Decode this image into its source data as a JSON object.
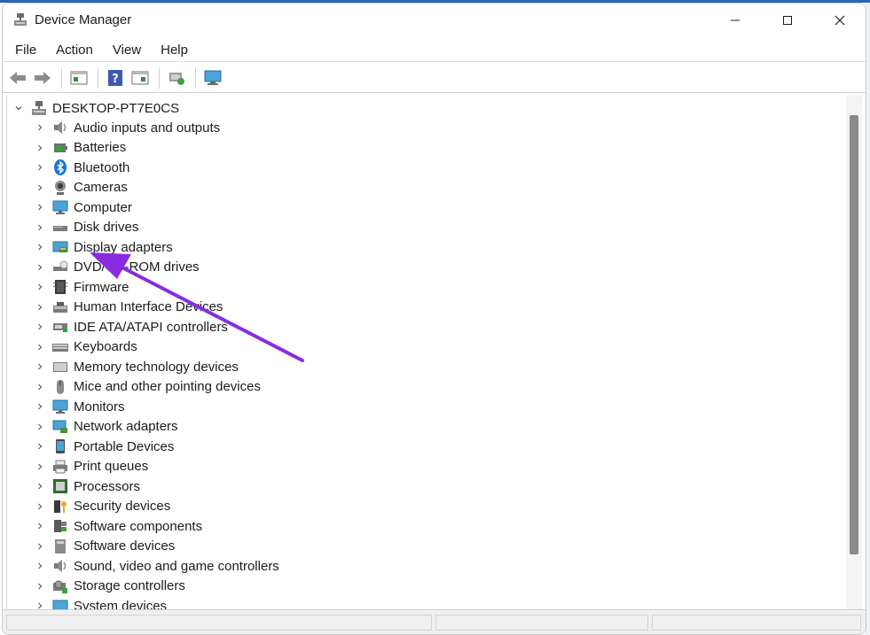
{
  "window": {
    "title": "Device Manager"
  },
  "menu": [
    "File",
    "Action",
    "View",
    "Help"
  ],
  "toolbar": {
    "buttons": [
      "back-arrow-icon",
      "forward-arrow-icon",
      "properties-icon",
      "help-icon",
      "view-icon",
      "update-driver-icon",
      "scan-hardware-icon"
    ]
  },
  "tree": {
    "root": "DESKTOP-PT7E0CS",
    "nodes": [
      {
        "label": "Audio inputs and outputs",
        "icon": "speaker-icon"
      },
      {
        "label": "Batteries",
        "icon": "battery-icon"
      },
      {
        "label": "Bluetooth",
        "icon": "bluetooth-icon"
      },
      {
        "label": "Cameras",
        "icon": "camera-icon"
      },
      {
        "label": "Computer",
        "icon": "monitor-icon"
      },
      {
        "label": "Disk drives",
        "icon": "disk-drive-icon"
      },
      {
        "label": "Display adapters",
        "icon": "display-adapter-icon"
      },
      {
        "label": "DVD/CD-ROM drives",
        "icon": "dvd-drive-icon"
      },
      {
        "label": "Firmware",
        "icon": "firmware-chip-icon"
      },
      {
        "label": "Human Interface Devices",
        "icon": "hid-icon"
      },
      {
        "label": "IDE ATA/ATAPI controllers",
        "icon": "ide-controller-icon"
      },
      {
        "label": "Keyboards",
        "icon": "keyboard-icon"
      },
      {
        "label": "Memory technology devices",
        "icon": "memory-icon"
      },
      {
        "label": "Mice and other pointing devices",
        "icon": "mouse-icon"
      },
      {
        "label": "Monitors",
        "icon": "monitor-icon"
      },
      {
        "label": "Network adapters",
        "icon": "network-adapter-icon"
      },
      {
        "label": "Portable Devices",
        "icon": "portable-device-icon"
      },
      {
        "label": "Print queues",
        "icon": "printer-icon"
      },
      {
        "label": "Processors",
        "icon": "processor-icon"
      },
      {
        "label": "Security devices",
        "icon": "security-key-icon"
      },
      {
        "label": "Software components",
        "icon": "software-components-icon"
      },
      {
        "label": "Software devices",
        "icon": "software-device-icon"
      },
      {
        "label": "Sound, video and game controllers",
        "icon": "speaker-icon"
      },
      {
        "label": "Storage controllers",
        "icon": "storage-controller-icon"
      },
      {
        "label": "System devices",
        "icon": "system-devices-icon"
      }
    ]
  },
  "annotation": {
    "color": "#8a2be2",
    "points_to": "Display adapters"
  }
}
